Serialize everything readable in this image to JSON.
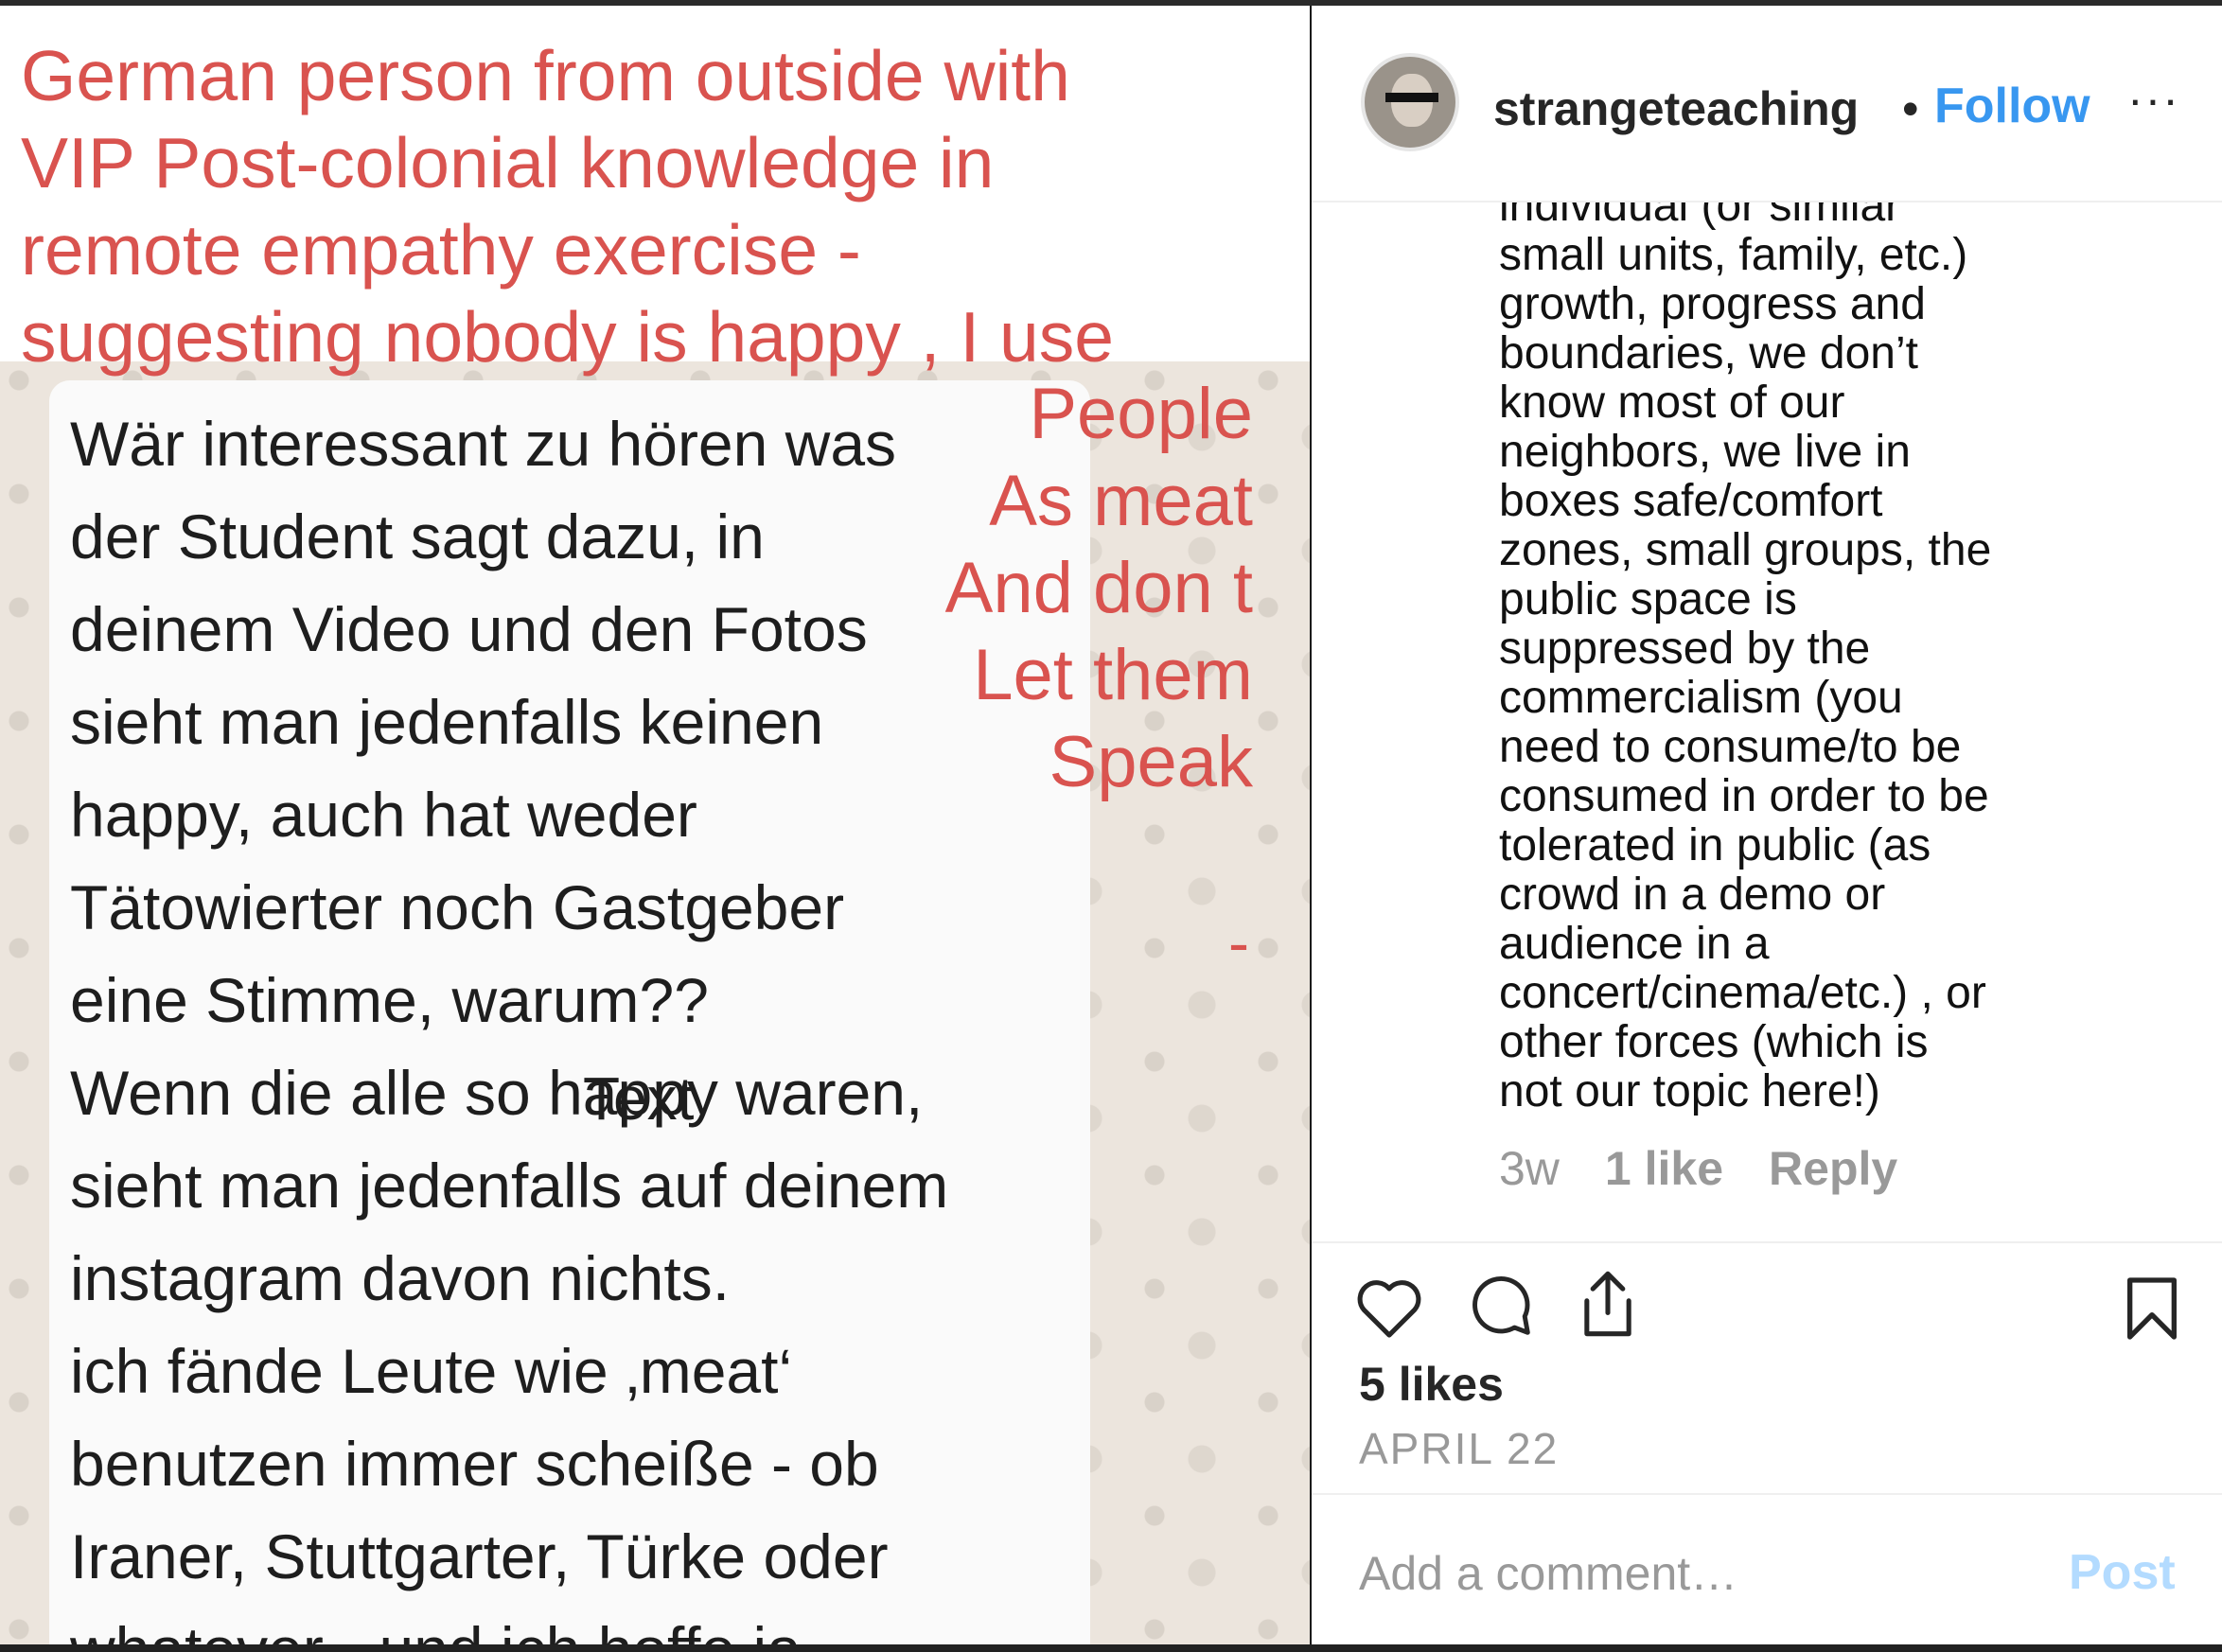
{
  "photo": {
    "caption": "German person from outside with\nVIP Post-colonial knowledge   in\nremote empathy exercise -\nsuggesting nobody is happy , I use",
    "chat_text": "Wär interessant zu hören was\nder Student sagt dazu, in\ndeinem Video und den Fotos\nsieht man jedenfalls keinen\nhappy, auch hat weder\nTätowierter noch Gastgeber\neine Stimme, warum??\nWenn die alle so happy waren,\nsieht man jedenfalls auf deinem\ninstagram davon nichts.\nich fände Leute wie ‚meat‘\nbenutzen immer scheiße - ob\nIraner, Stuttgarter, Türke oder\nwhatever - und ich hoffe ia",
    "red_side": "People\nAs meat\nAnd  don t\nLet them\nSpeak",
    "dash": "-",
    "overlay": "Text"
  },
  "post": {
    "username": "strangeteaching",
    "dot": "•",
    "follow": "Follow",
    "more": "···",
    "comment": "individual (or similar\nsmall units, family, etc.)\ngrowth, progress and\nboundaries, we don’t\nknow most of our\nneighbors, we live in\nboxes safe/comfort\nzones, small groups, the\npublic space is\nsuppressed by the\ncommercialism (you\nneed to consume/to be\nconsumed in order to be\ntolerated in public (as\ncrowd in a demo or\naudience in a\nconcert/cinema/etc.) , or\nother forces (which is\nnot our topic here!)",
    "comment_time": "3w",
    "comment_likes": "1 like",
    "comment_reply": "Reply",
    "likes": "5 likes",
    "date": "APRIL 22",
    "add_placeholder": "Add a comment…",
    "post_label": "Post",
    "icons": [
      "heart-icon",
      "comment-icon",
      "share-icon",
      "bookmark-icon"
    ],
    "colors": {
      "accent": "#3897f0",
      "caption_red": "#d9534f",
      "post_disabled": "#b3dbff"
    }
  }
}
